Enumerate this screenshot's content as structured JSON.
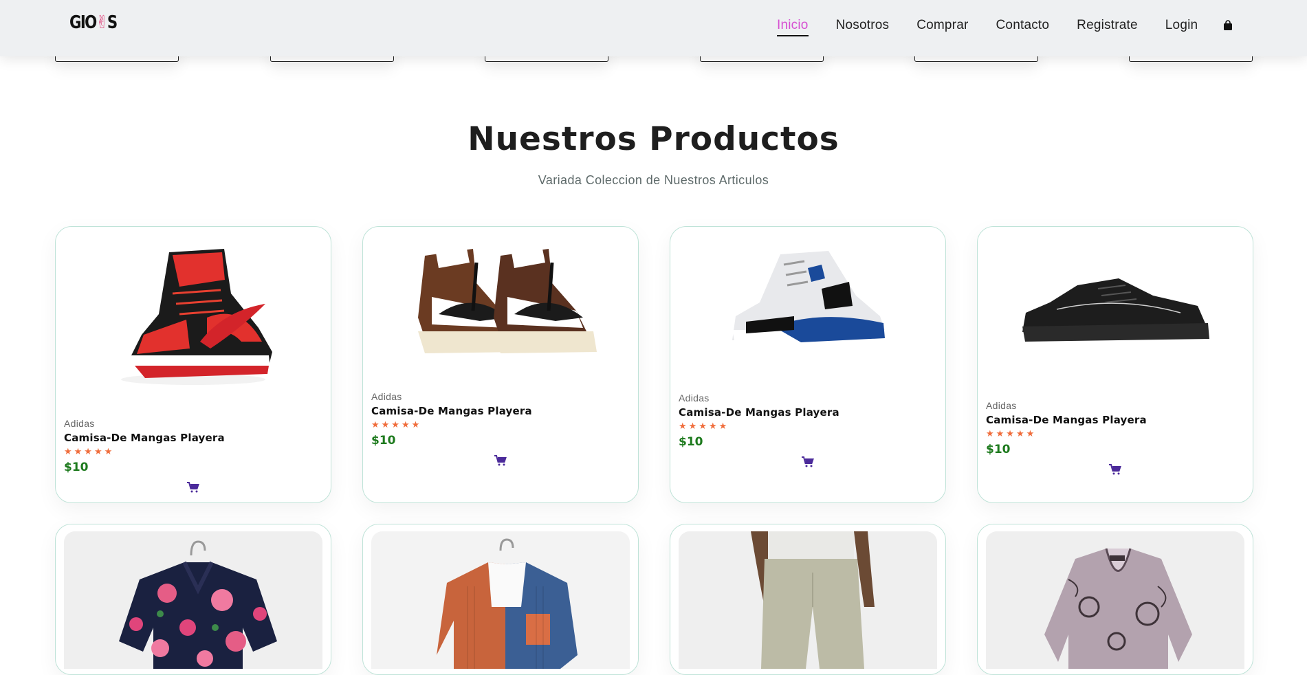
{
  "header": {
    "logo": "GIONS",
    "nav": [
      {
        "label": "Inicio",
        "active": true
      },
      {
        "label": "Nosotros",
        "active": false
      },
      {
        "label": "Comprar",
        "active": false
      },
      {
        "label": "Contacto",
        "active": false
      },
      {
        "label": "Registrate",
        "active": false
      },
      {
        "label": "Login",
        "active": false
      }
    ],
    "bag_icon": "shopping-bag-icon"
  },
  "section": {
    "title": "Nuestros Productos",
    "subtitle": "Variada Coleccion de Nuestros Articulos"
  },
  "products": [
    {
      "brand": "Adidas",
      "name": "Camisa-De Mangas Playera",
      "stars": "★★★★★",
      "price": "$10",
      "image": "red-black-high-top-sneaker"
    },
    {
      "brand": "Adidas",
      "name": "Camisa-De Mangas Playera",
      "stars": "★★★★★",
      "price": "$10",
      "image": "brown-white-high-top-sneakers"
    },
    {
      "brand": "Adidas",
      "name": "Camisa-De Mangas Playera",
      "stars": "★★★★★",
      "price": "$10",
      "image": "white-blue-sneaker"
    },
    {
      "brand": "Adidas",
      "name": "Camisa-De Mangas Playera",
      "stars": "★★★★★",
      "price": "$10",
      "image": "black-low-top-sneaker"
    }
  ],
  "products_row2": [
    {
      "image": "floral-shirt"
    },
    {
      "image": "orange-blue-corduroy-shirt"
    },
    {
      "image": "linen-pants"
    },
    {
      "image": "patterned-blouse"
    }
  ],
  "colors": {
    "accent": "#d64fd2",
    "price": "#1d7a1d",
    "stars": "#f06d3c",
    "cart": "#4b2a9a",
    "card_border": "#bfe3d8"
  }
}
